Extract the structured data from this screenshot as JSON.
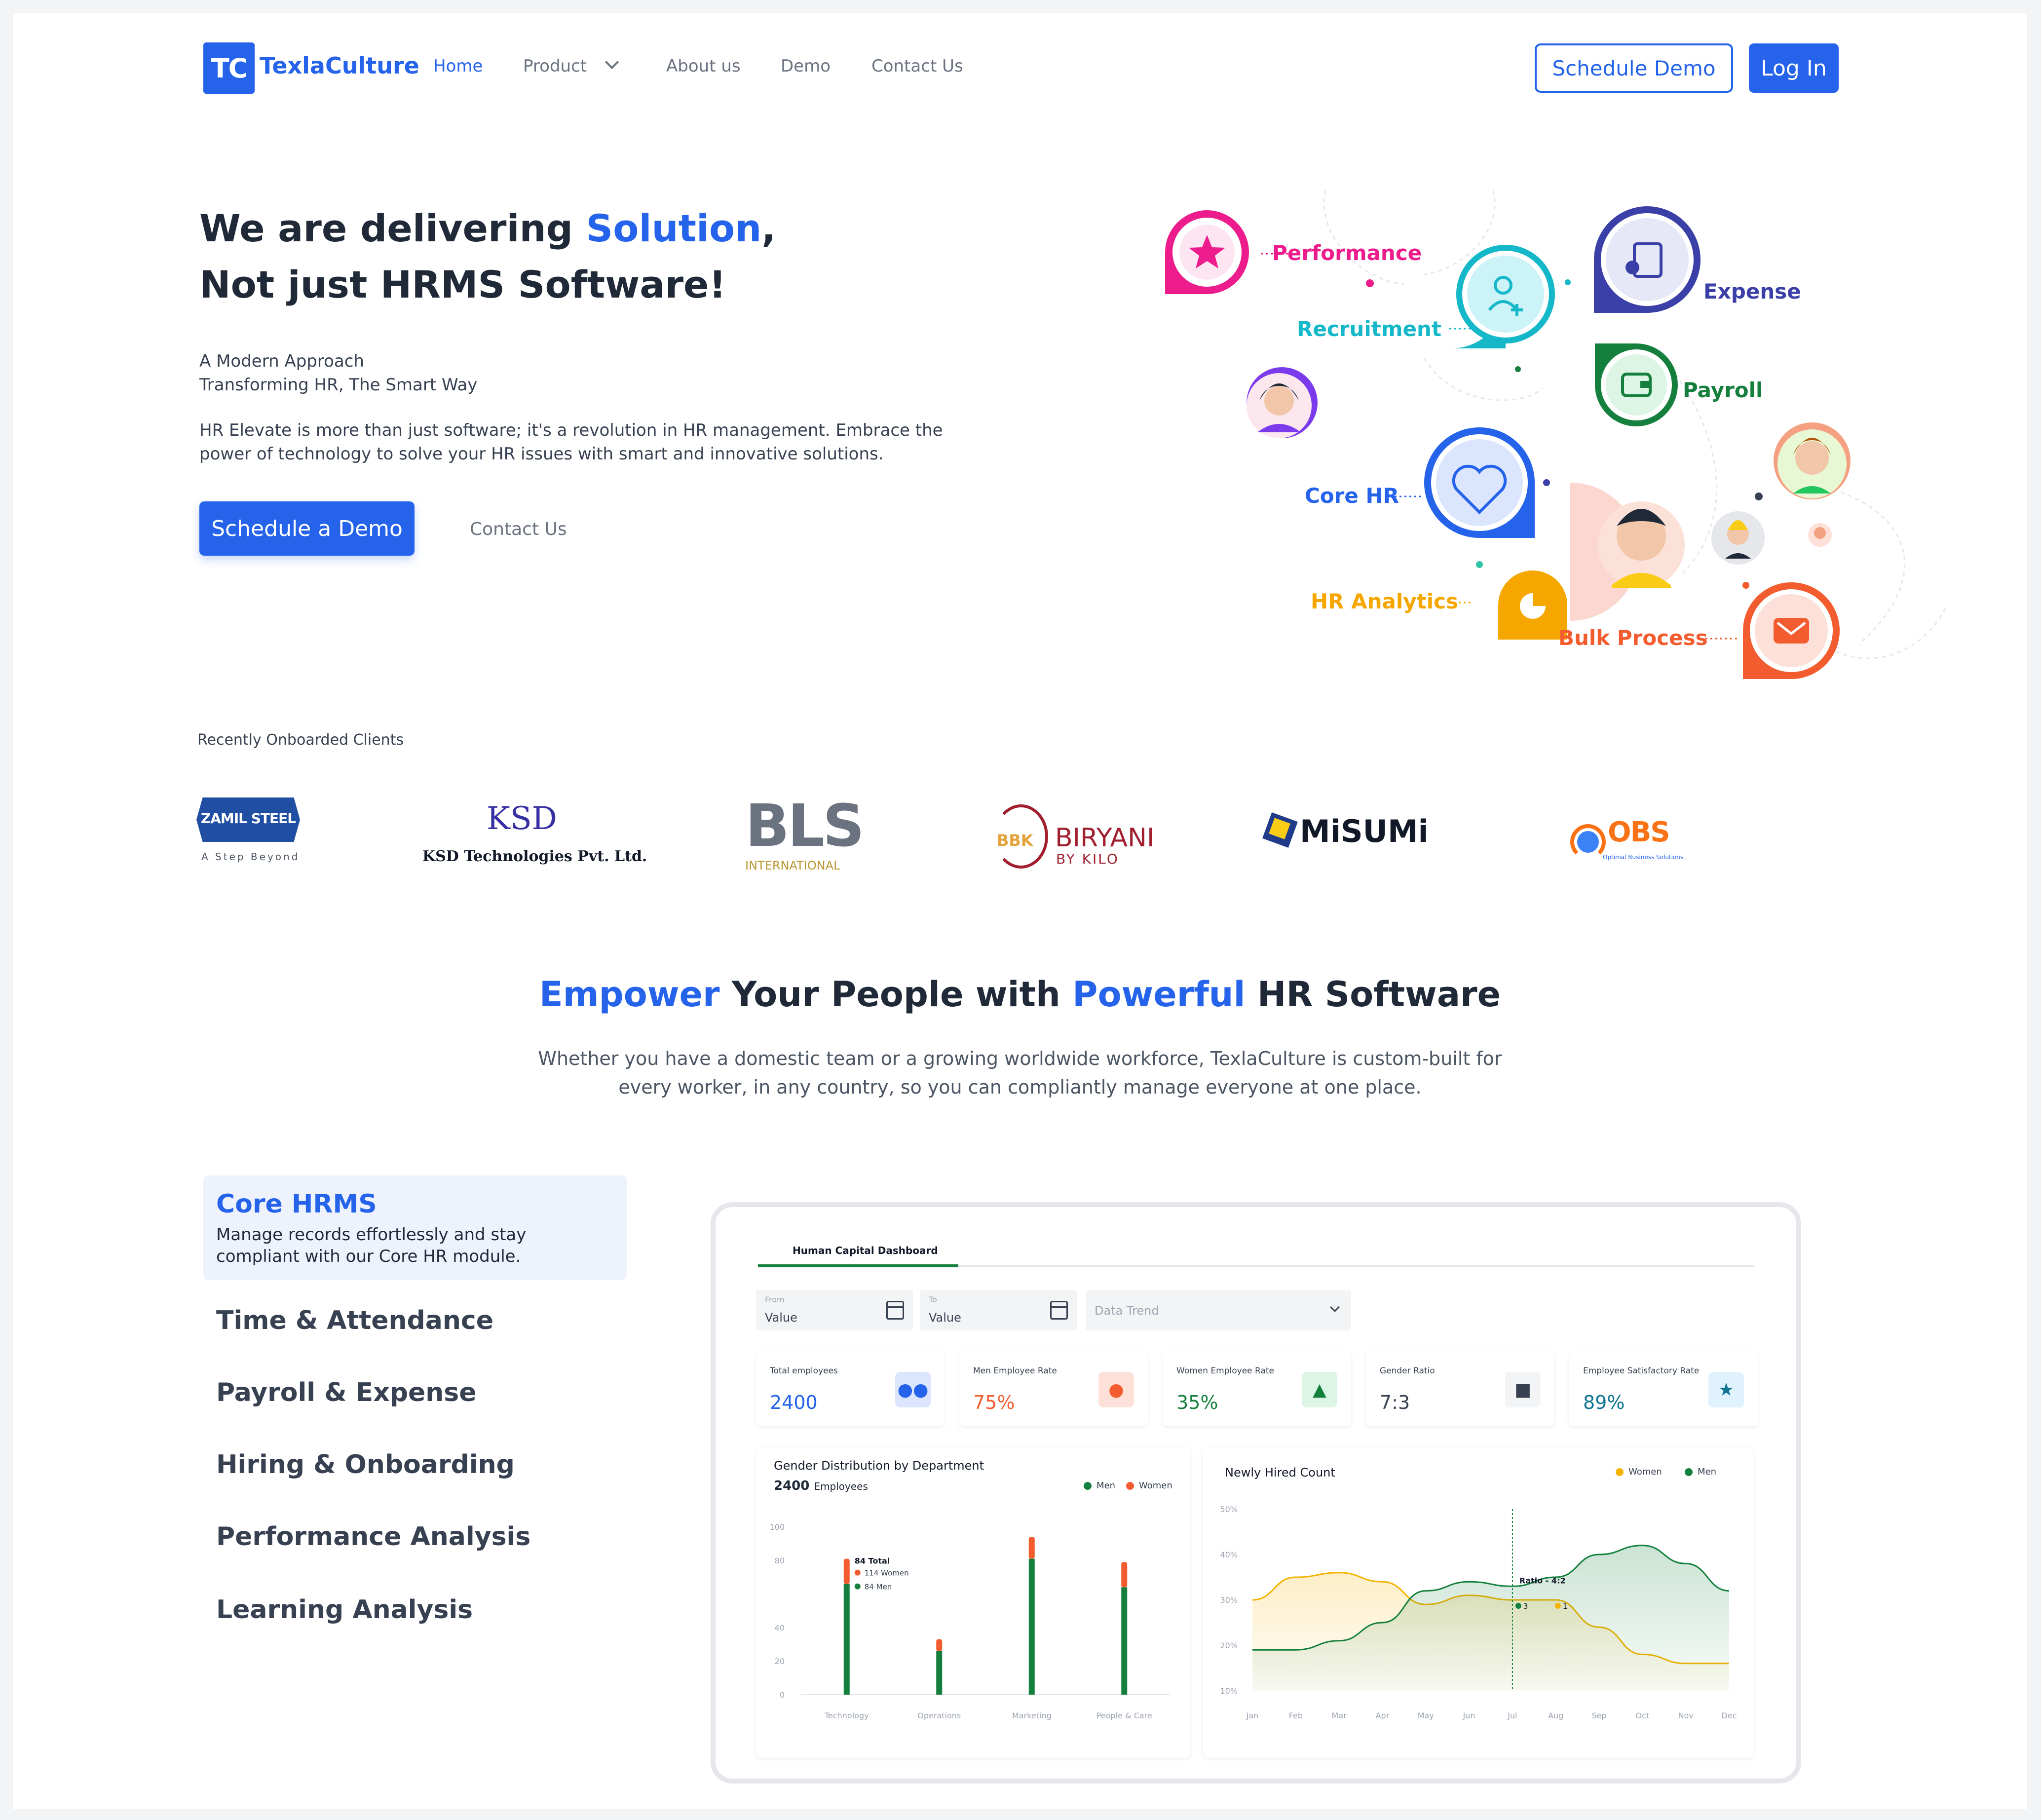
{
  "nav": {
    "logo_mark": "TC",
    "brand": "TexlaCulture",
    "links": [
      "Home",
      "Product",
      "About us",
      "Demo",
      "Contact Us"
    ],
    "schedule_demo": "Schedule Demo",
    "login": "Log In"
  },
  "hero": {
    "title_part1": "We are delivering ",
    "title_highlight": "Solution",
    "title_part2": ",",
    "title_line2": "Not just HRMS Software!",
    "subtitle_line1": "A Modern Approach",
    "subtitle_line2": "Transforming HR, The Smart Way",
    "description": "HR Elevate is more than just software; it's a revolution in HR management. Embrace the power of technology to solve your HR issues with smart and innovative solutions.",
    "cta": "Schedule a Demo",
    "contact": "Contact Us"
  },
  "illustration": {
    "labels": {
      "performance": "Performance",
      "recruitment": "Recruitment",
      "expense": "Expense",
      "payroll": "Payroll",
      "core_hr": "Core HR",
      "hr_analytics": "HR Analytics",
      "bulk_process": "Bulk Process"
    },
    "colors": {
      "performance": "#ec1c8c",
      "recruitment": "#14b8c9",
      "expense": "#3b3fa8",
      "payroll": "#15803d",
      "core_hr": "#2563eb",
      "hr_analytics": "#f5a700",
      "bulk_process": "#f25c2f"
    }
  },
  "clients": {
    "title": "Recently Onboarded Clients",
    "zamil": {
      "name": "ZAMIL STEEL",
      "tagline": "A Step Beyond"
    },
    "ksd": {
      "mark": "KSD",
      "name": "KSD Technologies Pvt. Ltd."
    },
    "bls": {
      "mark": "BLS",
      "sub": "INTERNATIONAL"
    },
    "biryani": {
      "mark": "BBK",
      "name": "BIRYANI",
      "sub": "BY KILO"
    },
    "misumi": {
      "name": "MiSUMi"
    },
    "obs": {
      "mark": "OBS",
      "sub": "Optimal Business Solutions"
    }
  },
  "empower": {
    "w1": "Empower",
    "w2": " Your People with ",
    "w3": "Powerful",
    "w4": " HR Software",
    "desc_line1": "Whether you have a domestic team or a growing worldwide workforce, TexlaCulture is custom-built for",
    "desc_line2": "every worker, in any country, so you can compliantly manage everyone at one place."
  },
  "features": {
    "active_title": "Core HRMS",
    "active_desc": "Manage records effortlessly and stay compliant with our Core HR module.",
    "items": [
      "Time & Attendance",
      "Payroll & Expense",
      "Hiring & Onboarding",
      "Performance Analysis",
      "Learning Analysis"
    ]
  },
  "dashboard": {
    "tab": "Human Capital Dashboard",
    "from_label": "From",
    "from_value": "Value",
    "to_label": "To",
    "to_value": "Value",
    "trend_placeholder": "Data Trend",
    "stats": [
      {
        "label": "Total employees",
        "value": "2400",
        "color": "#2563eb",
        "icon": "people-icon"
      },
      {
        "label": "Men Employee Rate",
        "value": "75%",
        "color": "#f25c2f",
        "icon": "man-icon"
      },
      {
        "label": "Women Employee Rate",
        "value": "35%",
        "color": "#15803d",
        "icon": "woman-icon"
      },
      {
        "label": "Gender Ratio",
        "value": "7:3",
        "color": "#374151",
        "icon": "ratio-icon"
      },
      {
        "label": "Employee Satisfactory Rate",
        "value": "89%",
        "color": "#0e7490",
        "icon": "star-icon"
      }
    ]
  },
  "chart_data": [
    {
      "type": "bar",
      "title": "Gender Distribution by Department",
      "subtitle_value": "2400",
      "subtitle_unit": "Employees",
      "categories": [
        "Technology",
        "Operations",
        "Marketing",
        "People & Care"
      ],
      "series": [
        {
          "name": "Men",
          "color": "#15803d",
          "values": [
            66,
            26,
            81,
            64
          ]
        },
        {
          "name": "Women",
          "color": "#f25c2f",
          "values": [
            15,
            7,
            13,
            15
          ]
        }
      ],
      "ylim": [
        0,
        100
      ],
      "yticks": [
        0,
        20,
        40,
        80,
        100
      ],
      "stacked": true,
      "tooltip": {
        "total_label": "Total",
        "total": "84",
        "women": "114 Women",
        "men": "84 Men"
      },
      "legend": "top-right"
    },
    {
      "type": "area",
      "title": "Newly Hired Count",
      "categories": [
        "Jan",
        "Feb",
        "Mar",
        "Apr",
        "May",
        "Jun",
        "Jul",
        "Aug",
        "Sep",
        "Oct",
        "Nov",
        "Dec"
      ],
      "series": [
        {
          "name": "Women",
          "color": "#f5b301",
          "values": [
            30,
            35,
            36,
            34,
            29,
            31,
            30,
            30,
            24,
            18,
            16,
            16
          ]
        },
        {
          "name": "Men",
          "color": "#15803d",
          "values": [
            19,
            19,
            21,
            25,
            32,
            34,
            33,
            35,
            40,
            42,
            38,
            32
          ]
        }
      ],
      "ylim": [
        10,
        50
      ],
      "yticks": [
        "10%",
        "20%",
        "30%",
        "40%",
        "50%"
      ],
      "tooltip": {
        "label": "Ratio - 4:2",
        "men": "3",
        "women": "1"
      },
      "legend": "top-right"
    }
  ]
}
